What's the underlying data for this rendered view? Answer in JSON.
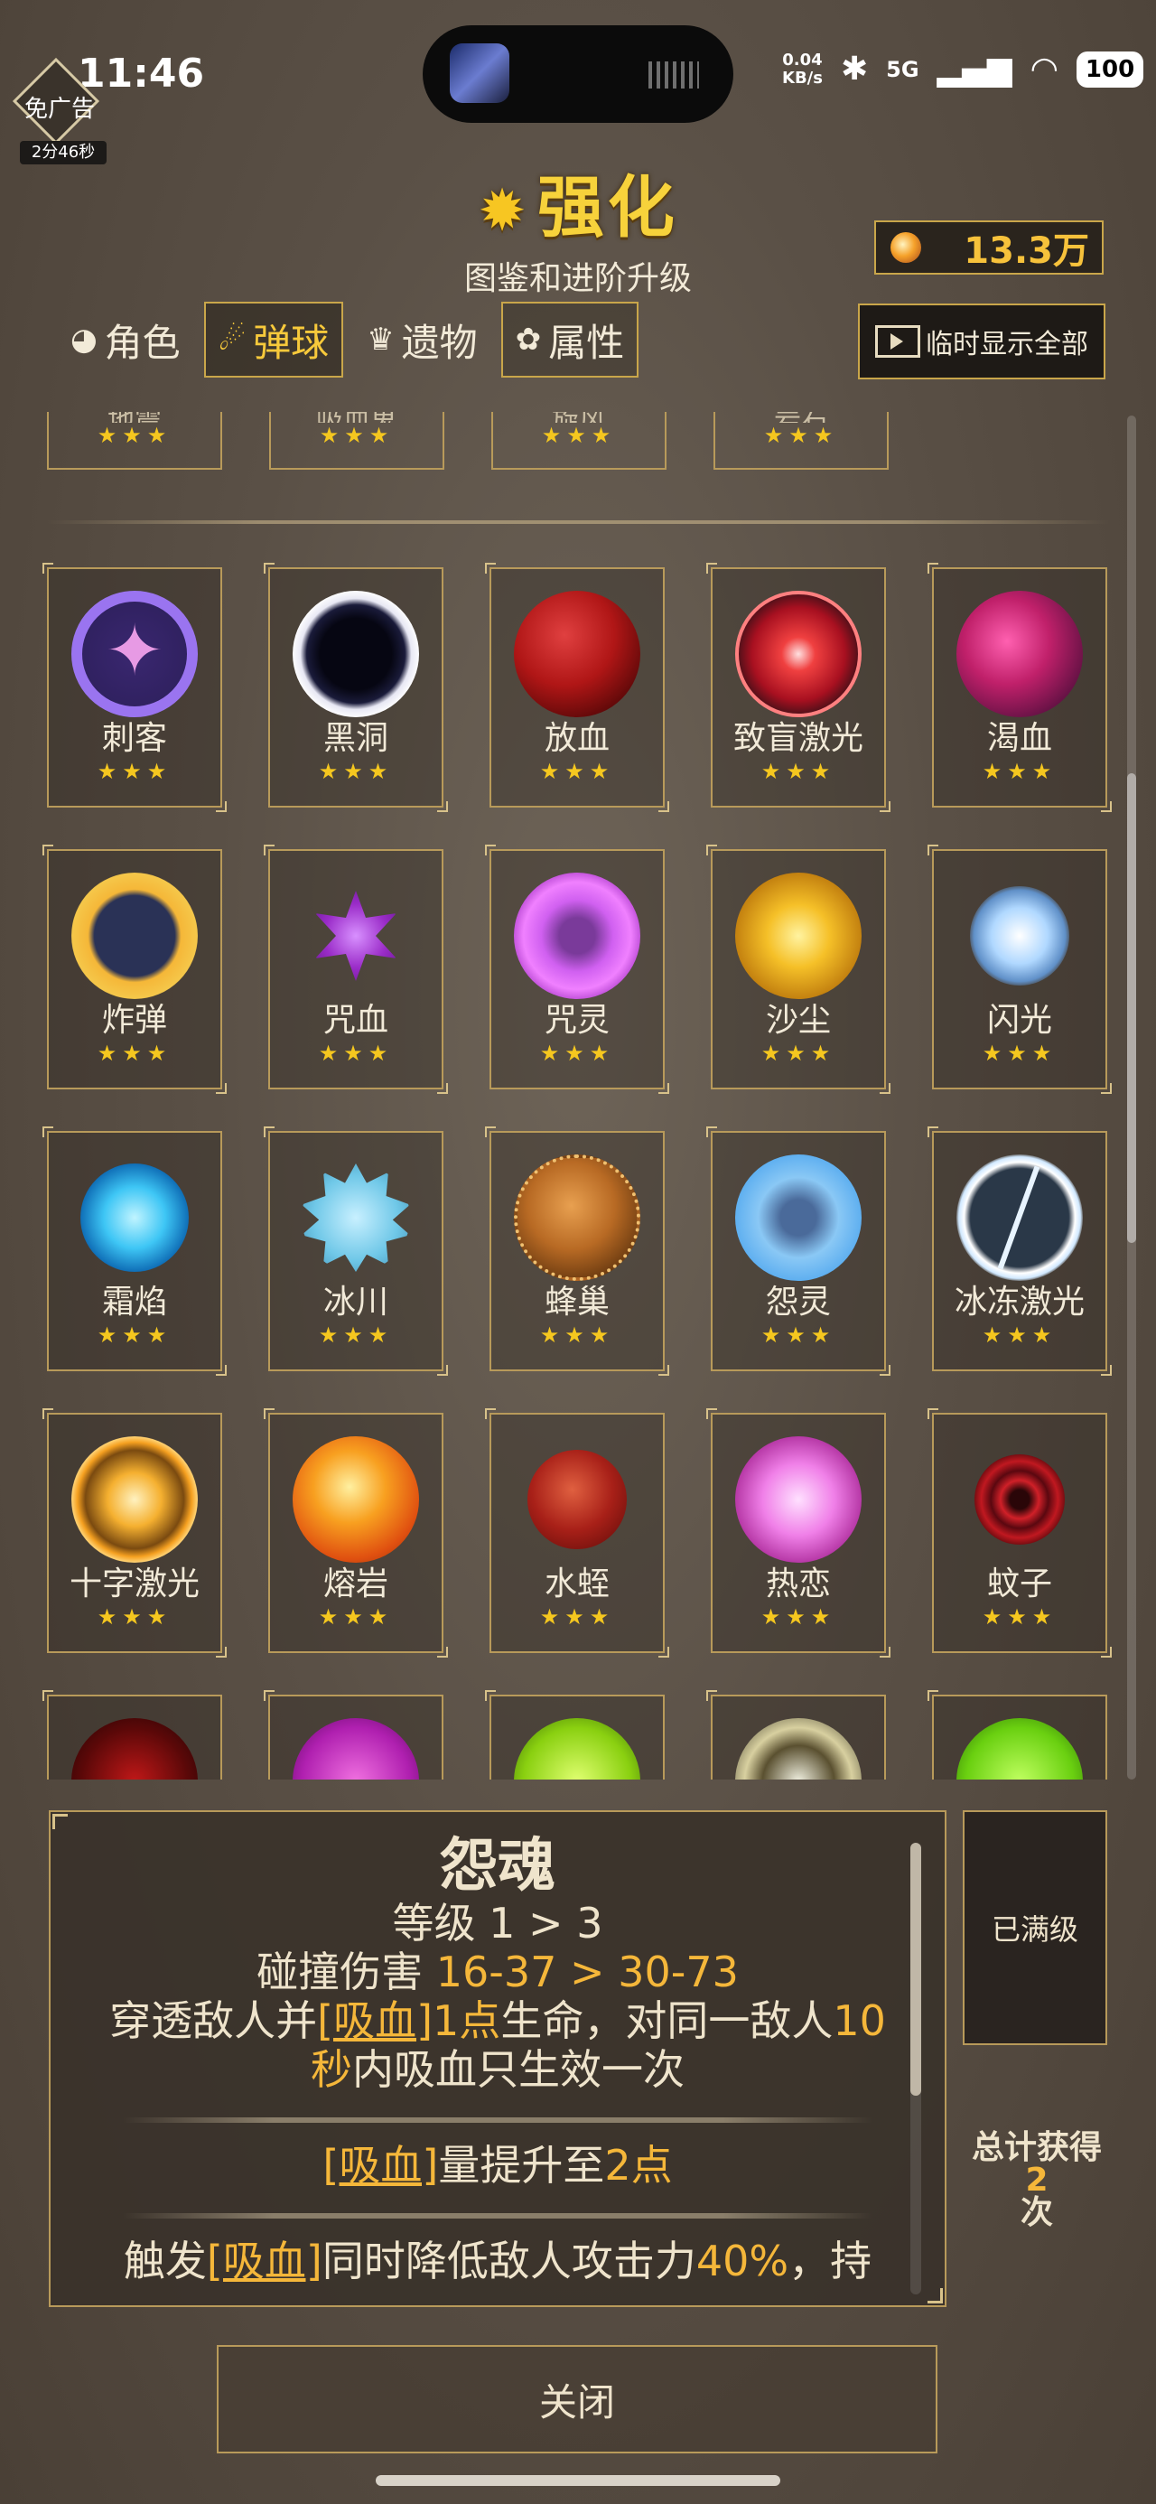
{
  "status": {
    "time": "11:46",
    "net_speed": "0.04",
    "net_unit": "KB/s",
    "signal": "5G",
    "battery": "100"
  },
  "ad": {
    "label": "免广告",
    "timer": "2分46秒"
  },
  "header": {
    "title": "强化",
    "subtitle": "图鉴和进阶升级",
    "currency": "13.3万"
  },
  "tabs": [
    {
      "label": "角色",
      "icon": "character-icon"
    },
    {
      "label": "弹球",
      "icon": "ball-icon"
    },
    {
      "label": "遗物",
      "icon": "relic-icon"
    },
    {
      "label": "属性",
      "icon": "attribute-icon"
    }
  ],
  "active_tab": "弹球",
  "show_all_label": "临时显示全部",
  "partial_row": [
    {
      "name": "地震",
      "stars": "★★★"
    },
    {
      "name": "吸血鬼",
      "stars": "★★★"
    },
    {
      "name": "旋风",
      "stars": "★★★"
    },
    {
      "name": "岩石",
      "stars": "★★★"
    }
  ],
  "balls": [
    {
      "name": "刺客",
      "stars": "★★★"
    },
    {
      "name": "黑洞",
      "stars": "★★★"
    },
    {
      "name": "放血",
      "stars": "★★★"
    },
    {
      "name": "致盲激光",
      "stars": "★★★"
    },
    {
      "name": "渴血",
      "stars": "★★★"
    },
    {
      "name": "炸弹",
      "stars": "★★★"
    },
    {
      "name": "咒血",
      "stars": "★★★"
    },
    {
      "name": "咒灵",
      "stars": "★★★"
    },
    {
      "name": "沙尘",
      "stars": "★★★"
    },
    {
      "name": "闪光",
      "stars": "★★★"
    },
    {
      "name": "霜焰",
      "stars": "★★★"
    },
    {
      "name": "冰川",
      "stars": "★★★"
    },
    {
      "name": "蜂巢",
      "stars": "★★★"
    },
    {
      "name": "怨灵",
      "stars": "★★★"
    },
    {
      "name": "冰冻激光",
      "stars": "★★★"
    },
    {
      "name": "十字激光",
      "stars": "★★★"
    },
    {
      "name": "熔岩",
      "stars": "★★★"
    },
    {
      "name": "水蛭",
      "stars": "★★★"
    },
    {
      "name": "热恋",
      "stars": "★★★"
    },
    {
      "name": "蚊子",
      "stars": "★★★"
    }
  ],
  "detail": {
    "title": "怨魂",
    "level_label": "等级 1 > 3",
    "collision_label": "碰撞伤害",
    "collision_value": "16-37 > 30-73",
    "desc_a": "穿透敌人并",
    "desc_tag": "[吸血]",
    "desc_b": "1点",
    "desc_c": "生命，对同一敌人",
    "desc_d": "10",
    "desc_e": "秒",
    "desc_f": "内吸血只生效一次",
    "upgrade1_tag": "[吸血]",
    "upgrade1_text": "量提升至",
    "upgrade1_value": "2点",
    "upgrade2_a": "触发",
    "upgrade2_tag": "[吸血]",
    "upgrade2_b": "同时降低敌人攻击力",
    "upgrade2_value": "40%",
    "upgrade2_c": "，持"
  },
  "maxed_label": "已满级",
  "total": {
    "label": "总计获得",
    "count": "2",
    "unit": "次"
  },
  "close_label": "关闭"
}
